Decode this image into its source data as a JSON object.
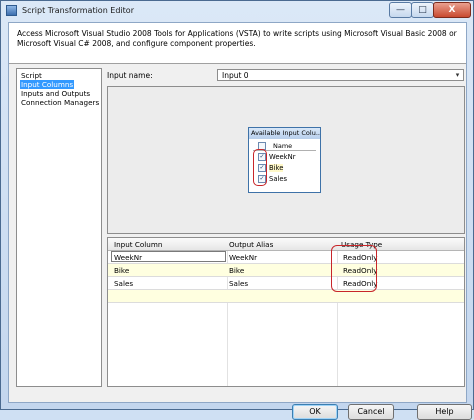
{
  "window": {
    "title": "Script Transformation Editor",
    "minimize_glyph": "—",
    "maximize_glyph": "□",
    "close_glyph": "X"
  },
  "description": "Access Microsoft Visual Studio 2008 Tools for Applications (VSTA) to write scripts using Microsoft Visual Basic 2008 or Microsoft Visual C# 2008, and configure component properties.",
  "nav": {
    "items": [
      {
        "label": "Script",
        "selected": false
      },
      {
        "label": "Input Columns",
        "selected": true
      },
      {
        "label": "Inputs and Outputs",
        "selected": false
      },
      {
        "label": "Connection Managers",
        "selected": false
      }
    ]
  },
  "input": {
    "label": "Input name:",
    "value": "Input 0",
    "dropdown_icon": "chevron-down-icon"
  },
  "available_columns": {
    "title": "Available Input Colu...",
    "header": "Name",
    "columns": [
      {
        "name": "WeekNr",
        "checked": true
      },
      {
        "name": "Bike",
        "checked": true
      },
      {
        "name": "Sales",
        "checked": true
      }
    ],
    "check_glyph": "✓"
  },
  "grid": {
    "headers": [
      "Input Column",
      "Output Alias",
      "Usage Type"
    ],
    "rows": [
      {
        "input_column": "WeekNr",
        "output_alias": "WeekNr",
        "usage_type": "ReadOnly"
      },
      {
        "input_column": "Bike",
        "output_alias": "Bike",
        "usage_type": "ReadOnly"
      },
      {
        "input_column": "Sales",
        "output_alias": "Sales",
        "usage_type": "ReadOnly"
      }
    ]
  },
  "buttons": {
    "ok": "OK",
    "cancel": "Cancel",
    "help": "Help"
  },
  "colors": {
    "selection": "#3399ff",
    "highlight_annotation": "#c8262a",
    "row_alt": "#ffffe0"
  }
}
